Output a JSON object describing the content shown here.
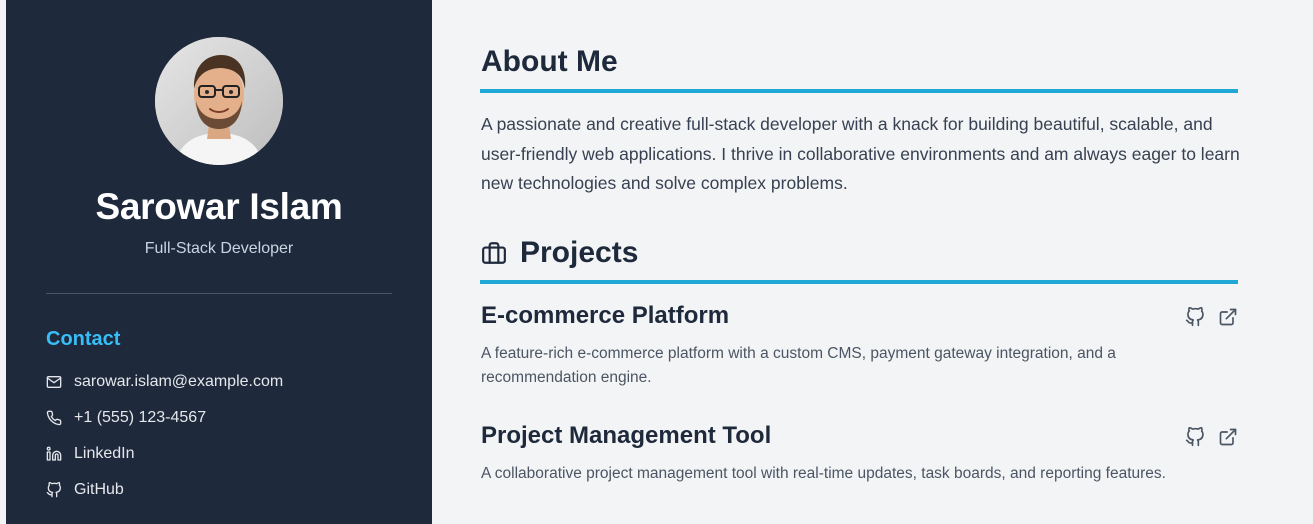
{
  "profile": {
    "name": "Sarowar Islam",
    "role": "Full-Stack Developer"
  },
  "contact": {
    "heading": "Contact",
    "items": [
      {
        "icon": "mail-icon",
        "label": "sarowar.islam@example.com"
      },
      {
        "icon": "phone-icon",
        "label": "+1 (555) 123-4567"
      },
      {
        "icon": "linkedin-icon",
        "label": "LinkedIn"
      },
      {
        "icon": "github-icon",
        "label": "GitHub"
      }
    ]
  },
  "about": {
    "title": "About Me",
    "text": "A passionate and creative full-stack developer with a knack for building beautiful, scalable, and user-friendly web applications. I thrive in collaborative environments and am always eager to learn new technologies and solve complex problems."
  },
  "projects": {
    "title": "Projects",
    "icon": "briefcase-icon",
    "items": [
      {
        "title": "E-commerce Platform",
        "description": "A feature-rich e-commerce platform with a custom CMS, payment gateway integration, and a recommendation engine."
      },
      {
        "title": "Project Management Tool",
        "description": "A collaborative project management tool with real-time updates, task boards, and reporting features."
      }
    ]
  },
  "colors": {
    "sidebar": "#1e293b",
    "accent": "#38bdf8",
    "rule": "#1fa8d6",
    "background": "#f3f4f6"
  }
}
